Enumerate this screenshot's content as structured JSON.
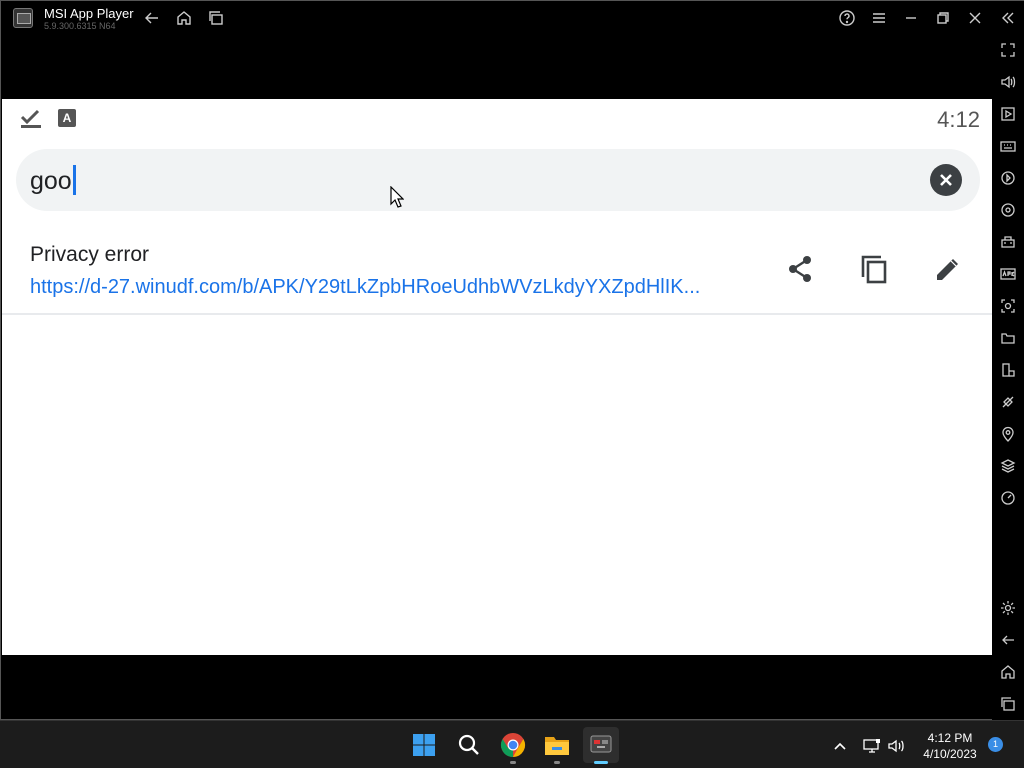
{
  "titlebar": {
    "app_title": "MSI App Player",
    "app_version": "5.9.300.6315  N64",
    "buttons": [
      "back-icon",
      "home-icon",
      "multi-instance-icon",
      "help-icon",
      "menu-icon",
      "minimize-icon",
      "restore-icon",
      "close-icon",
      "collapse-sidebar-icon"
    ]
  },
  "sidebar": {
    "buttons": [
      "fullscreen-icon",
      "volume-icon",
      "media-icon",
      "keyboard-icon",
      "macro-icon",
      "sync-icon",
      "gamepad-icon",
      "apk-icon",
      "screenshot-icon",
      "folder-icon",
      "rotate-icon",
      "eco-mode-icon",
      "location-icon",
      "layers-icon",
      "performance-icon",
      "settings-icon",
      "android-back-icon",
      "android-home-icon",
      "android-recents-icon"
    ]
  },
  "android": {
    "status": {
      "clock": "4:12",
      "icons": [
        "check-icon",
        "keyboard-a-icon"
      ]
    },
    "search": {
      "query": "goo"
    },
    "result": {
      "title": "Privacy error",
      "url": "https://d-27.winudf.com/b/APK/Y29tLkZpbHRoeUdhbWVzLkdyYXZpdHlIK..."
    }
  },
  "taskbar": {
    "apps": [
      "windows-start-icon",
      "search-icon",
      "chrome-icon",
      "file-explorer-icon",
      "msi-app-player-icon"
    ],
    "time": "4:12 PM",
    "date": "4/10/2023",
    "notification_count": "1"
  },
  "colors": {
    "accent": "#1a73e8",
    "taskbar_active": "#60cdff"
  }
}
